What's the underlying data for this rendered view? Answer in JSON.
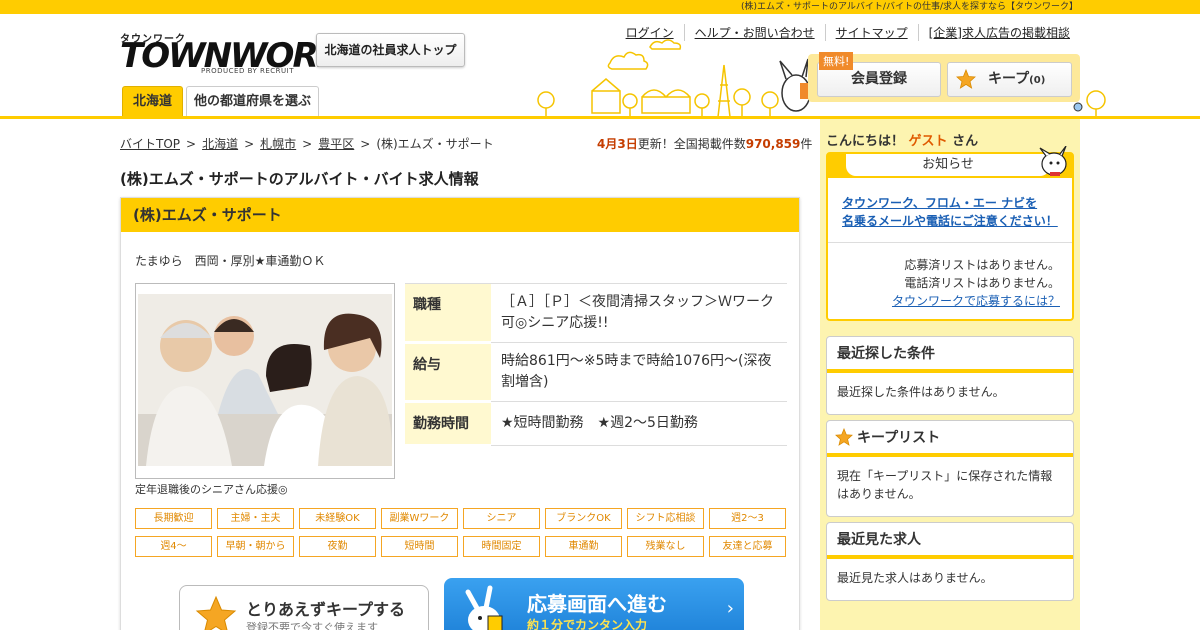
{
  "topbar": {
    "text": "(株)エムズ・サポートのアルバイト/バイトの仕事/求人を探すなら【タウンワーク】"
  },
  "logo": {
    "line1": "タウンワーク",
    "line2": "TOWNWORK",
    "line3": "PRODUCED BY RECRUIT"
  },
  "header": {
    "top_button": "北海道の社員求人トップ",
    "links": [
      "ログイン",
      "ヘルプ・お問い合わせ",
      "サイトマップ",
      "[企業]求人広告の掲載相談"
    ],
    "free_tag": "無料!",
    "member_button": "会員登録",
    "keep_button": "キープ",
    "keep_count": "(0)"
  },
  "tabs": {
    "hokkaido": "北海道",
    "other": "他の都道府県を選ぶ"
  },
  "breadcrumb": [
    "バイトTOP",
    "北海道",
    "札幌市",
    "豊平区",
    "(株)エムズ・サポート"
  ],
  "updated": {
    "date": "4月3日",
    "mid": "更新！全国掲載件数",
    "count": "970,859",
    "unit": "件"
  },
  "page_title": "(株)エムズ・サポートのアルバイト・バイト求人情報",
  "job": {
    "company": "(株)エムズ・サポート",
    "catch": "たまゆら　西岡・厚別★車通勤ＯＫ",
    "photo_caption": "定年退職後のシニアさん応援◎",
    "rows": [
      {
        "label": "職種",
        "value": "［Ａ］［Ｐ］＜夜間清掃スタッフ＞Ｗワーク可◎シニア応援!!"
      },
      {
        "label": "給与",
        "value": "時給861円～※5時まで時給1076円～(深夜割増含)"
      },
      {
        "label": "勤務時間",
        "value": "★短時間勤務　★週2～5日勤務"
      }
    ],
    "tags": [
      "長期歓迎",
      "主婦・主夫",
      "未経験OK",
      "副業Wワーク",
      "シニア",
      "ブランクOK",
      "シフト応相談",
      "週2～3",
      "週4～",
      "早朝・朝から",
      "夜勤",
      "短時間",
      "時間固定",
      "車通勤",
      "残業なし",
      "友達と応募"
    ],
    "keep_now": {
      "title": "とりあえずキープする",
      "sub": "登録不要で今すぐ使えます"
    },
    "apply": {
      "title": "応募画面へ進む",
      "sub": "約１分でカンタン入力"
    }
  },
  "sidebar": {
    "greeting_pre": "こんにちは！",
    "greeting_guest": "ゲスト",
    "greeting_post": "さん",
    "notice_title": "お知らせ",
    "notice_link_1": "タウンワーク、フロム・エー ナビを",
    "notice_link_2": "名乗るメールや電話にご注意ください！",
    "applied_none": "応募済リストはありません。",
    "called_none": "電話済リストはありません。",
    "how_to_apply": "タウンワークで応募するには？",
    "recent_search_title": "最近探した条件",
    "recent_search_body": "最近探した条件はありません。",
    "keep_list_title": "キープリスト",
    "keep_list_body": "現在「キープリスト」に保存された情報はありません。",
    "recent_view_title": "最近見た求人",
    "recent_view_body": "最近見た求人はありません。"
  },
  "colors": {
    "brand_yellow": "#ffcc00",
    "side_bg": "#fdf4b0",
    "link_blue": "#1a5fb4",
    "accent_orange": "#e05a00",
    "apply_blue": "#1c7fd6"
  }
}
